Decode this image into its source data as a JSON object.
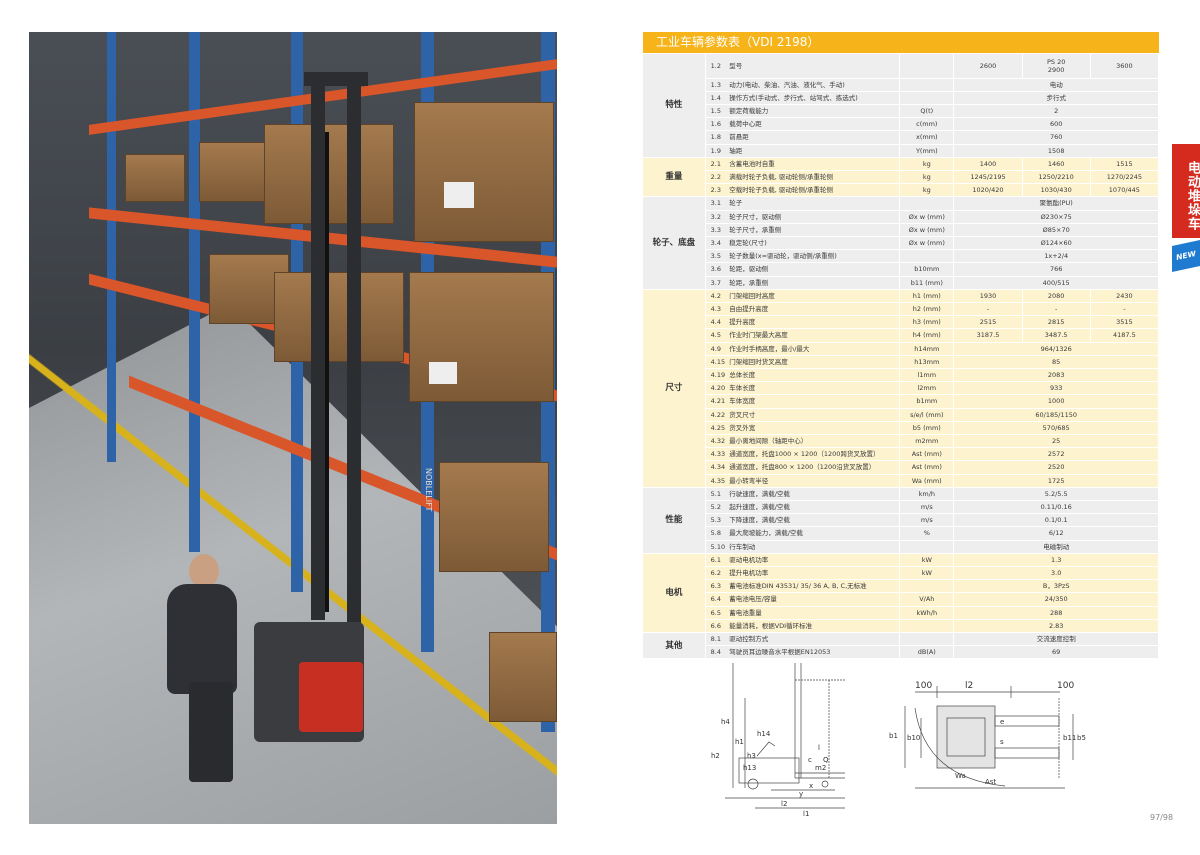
{
  "photo": {
    "brand_text": "NOBLELIFT"
  },
  "table": {
    "title": "工业车辆参数表（VDI 2198）",
    "model_cols": [
      {
        "top": "",
        "bottom": "2600"
      },
      {
        "top": "PS 20",
        "bottom": "2900"
      },
      {
        "top": "",
        "bottom": "3600"
      }
    ],
    "sections": [
      {
        "name": "特性",
        "style": "grey",
        "rows": [
          {
            "num": "1.2",
            "param": "型号",
            "unit": "",
            "values": []
          },
          {
            "num": "1.3",
            "param": "动力(电动、柴油、汽油、液化气、手动)",
            "unit": "",
            "values": [
              "电动"
            ]
          },
          {
            "num": "1.4",
            "param": "操作方式(手动式、步行式、站驾式、拣选式)",
            "unit": "",
            "values": [
              "步行式"
            ]
          },
          {
            "num": "1.5",
            "param": "额定荷载能力",
            "unit": "Q(t)",
            "values": [
              "2"
            ]
          },
          {
            "num": "1.6",
            "param": "载荷中心距",
            "unit": "c(mm)",
            "values": [
              "600"
            ]
          },
          {
            "num": "1.8",
            "param": "前悬距",
            "unit": "x(mm)",
            "values": [
              "760"
            ]
          },
          {
            "num": "1.9",
            "param": "轴距",
            "unit": "Y(mm)",
            "values": [
              "1508"
            ]
          }
        ]
      },
      {
        "name": "重量",
        "style": "yel",
        "rows": [
          {
            "num": "2.1",
            "param": "含蓄电池时自重",
            "unit": "kg",
            "values": [
              "1400",
              "1460",
              "1515"
            ]
          },
          {
            "num": "2.2",
            "param": "满载时轮子负载, 驱动轮侧/承重轮侧",
            "unit": "kg",
            "values": [
              "1245/2195",
              "1250/2210",
              "1270/2245"
            ]
          },
          {
            "num": "2.3",
            "param": "空载时轮子负载, 驱动轮侧/承重轮侧",
            "unit": "kg",
            "values": [
              "1020/420",
              "1030/430",
              "1070/445"
            ]
          }
        ]
      },
      {
        "name": "轮子、底盘",
        "style": "grey",
        "rows": [
          {
            "num": "3.1",
            "param": "轮子",
            "unit": "",
            "values": [
              "聚氨酯(PU)"
            ]
          },
          {
            "num": "3.2",
            "param": "轮子尺寸，驱动侧",
            "unit": "Øx w (mm)",
            "values": [
              "Ø230×75"
            ]
          },
          {
            "num": "3.3",
            "param": "轮子尺寸，承重侧",
            "unit": "Øx w (mm)",
            "values": [
              "Ø85×70"
            ]
          },
          {
            "num": "3.4",
            "param": "稳定轮(尺寸)",
            "unit": "Øx w (mm)",
            "values": [
              "Ø124×60"
            ]
          },
          {
            "num": "3.5",
            "param": "轮子数量(x=驱动轮，驱动侧/承重侧)",
            "unit": "",
            "values": [
              "1x+2/4"
            ]
          },
          {
            "num": "3.6",
            "param": "轮距，驱动侧",
            "unit": "b10mm",
            "values": [
              "766"
            ]
          },
          {
            "num": "3.7",
            "param": "轮距，承重侧",
            "unit": "b11 (mm)",
            "values": [
              "400/515"
            ]
          }
        ]
      },
      {
        "name": "尺寸",
        "style": "yel",
        "rows": [
          {
            "num": "4.2",
            "param": "门架缩回时高度",
            "unit": "h1 (mm)",
            "values": [
              "1930",
              "2080",
              "2430"
            ]
          },
          {
            "num": "4.3",
            "param": "自由提升高度",
            "unit": "h2 (mm)",
            "values": [
              "-",
              "-",
              "-"
            ]
          },
          {
            "num": "4.4",
            "param": "提升高度",
            "unit": "h3 (mm)",
            "values": [
              "2515",
              "2815",
              "3515"
            ]
          },
          {
            "num": "4.5",
            "param": "作业时门架最大高度",
            "unit": "h4 (mm)",
            "values": [
              "3187.5",
              "3487.5",
              "4187.5"
            ]
          },
          {
            "num": "4.9",
            "param": "作业时手柄高度，最小/最大",
            "unit": "h14mm",
            "values": [
              "964/1326"
            ]
          },
          {
            "num": "4.15",
            "param": "门架缩回时货叉高度",
            "unit": "h13mm",
            "values": [
              "85"
            ]
          },
          {
            "num": "4.19",
            "param": "总体长度",
            "unit": "l1mm",
            "values": [
              "2083"
            ]
          },
          {
            "num": "4.20",
            "param": "车体长度",
            "unit": "l2mm",
            "values": [
              "933"
            ]
          },
          {
            "num": "4.21",
            "param": "车体宽度",
            "unit": "b1mm",
            "values": [
              "1000"
            ]
          },
          {
            "num": "4.22",
            "param": "货叉尺寸",
            "unit": "s/e/l (mm)",
            "values": [
              "60/185/1150"
            ]
          },
          {
            "num": "4.25",
            "param": "货叉外宽",
            "unit": "b5 (mm)",
            "values": [
              "570/685"
            ]
          },
          {
            "num": "4.32",
            "param": "最小离地间隙（轴距中心）",
            "unit": "m2mm",
            "values": [
              "25"
            ]
          },
          {
            "num": "4.33",
            "param": "通道宽度，托盘1000 × 1200（1200跨货叉放置）",
            "unit": "Ast (mm)",
            "values": [
              "2572"
            ]
          },
          {
            "num": "4.34",
            "param": "通道宽度，托盘800 × 1200（1200沿货叉放置）",
            "unit": "Ast (mm)",
            "values": [
              "2520"
            ]
          },
          {
            "num": "4.35",
            "param": "最小转弯半径",
            "unit": "Wa (mm)",
            "values": [
              "1725"
            ]
          }
        ]
      },
      {
        "name": "性能",
        "style": "grey",
        "rows": [
          {
            "num": "5.1",
            "param": "行驶速度，满载/空载",
            "unit": "km/h",
            "values": [
              "5.2/5.5"
            ]
          },
          {
            "num": "5.2",
            "param": "起升速度，满载/空载",
            "unit": "m/s",
            "values": [
              "0.11/0.16"
            ]
          },
          {
            "num": "5.3",
            "param": "下降速度，满载/空载",
            "unit": "m/s",
            "values": [
              "0.1/0.1"
            ]
          },
          {
            "num": "5.8",
            "param": "最大爬坡能力，满载/空载",
            "unit": "%",
            "values": [
              "6/12"
            ]
          },
          {
            "num": "5.10",
            "param": "行车制动",
            "unit": "",
            "values": [
              "电磁制动"
            ]
          }
        ]
      },
      {
        "name": "电机",
        "style": "yel",
        "rows": [
          {
            "num": "6.1",
            "param": "驱动电机功率",
            "unit": "kW",
            "values": [
              "1.3"
            ]
          },
          {
            "num": "6.2",
            "param": "提升电机功率",
            "unit": "kW",
            "values": [
              "3.0"
            ]
          },
          {
            "num": "6.3",
            "param": "蓄电池标准DIN 43531/ 35/ 36 A, B, C,无标准",
            "unit": "",
            "values": [
              "B，3PzS"
            ]
          },
          {
            "num": "6.4",
            "param": "蓄电池电压/容量",
            "unit": "V/Ah",
            "values": [
              "24/350"
            ]
          },
          {
            "num": "6.5",
            "param": "蓄电池重量",
            "unit": "kWh/h",
            "values": [
              "288"
            ]
          },
          {
            "num": "6.6",
            "param": "能量消耗，根据VDI循环标准",
            "unit": "",
            "values": [
              "2.83"
            ]
          }
        ]
      },
      {
        "name": "其他",
        "style": "grey",
        "rows": [
          {
            "num": "8.1",
            "param": "驱动控制方式",
            "unit": "",
            "values": [
              "交流速度控制"
            ]
          },
          {
            "num": "8.4",
            "param": "驾驶员耳边噪音水平根据EN12053",
            "unit": "dB(A)",
            "values": [
              "69"
            ]
          }
        ]
      }
    ]
  },
  "side_tab": {
    "label": "电动堆垛车",
    "new_label": "NEW"
  },
  "diagram": {
    "side_labels": [
      "h4",
      "h1",
      "h3",
      "h14",
      "h13",
      "l",
      "c",
      "Q",
      "x",
      "y",
      "l2",
      "l1",
      "m2",
      "h2"
    ],
    "top_labels": [
      "100",
      "l2",
      "100",
      "b1",
      "b10",
      "b5",
      "b11",
      "e",
      "s",
      "Wa",
      "Ast"
    ]
  },
  "page_number": "97/98"
}
